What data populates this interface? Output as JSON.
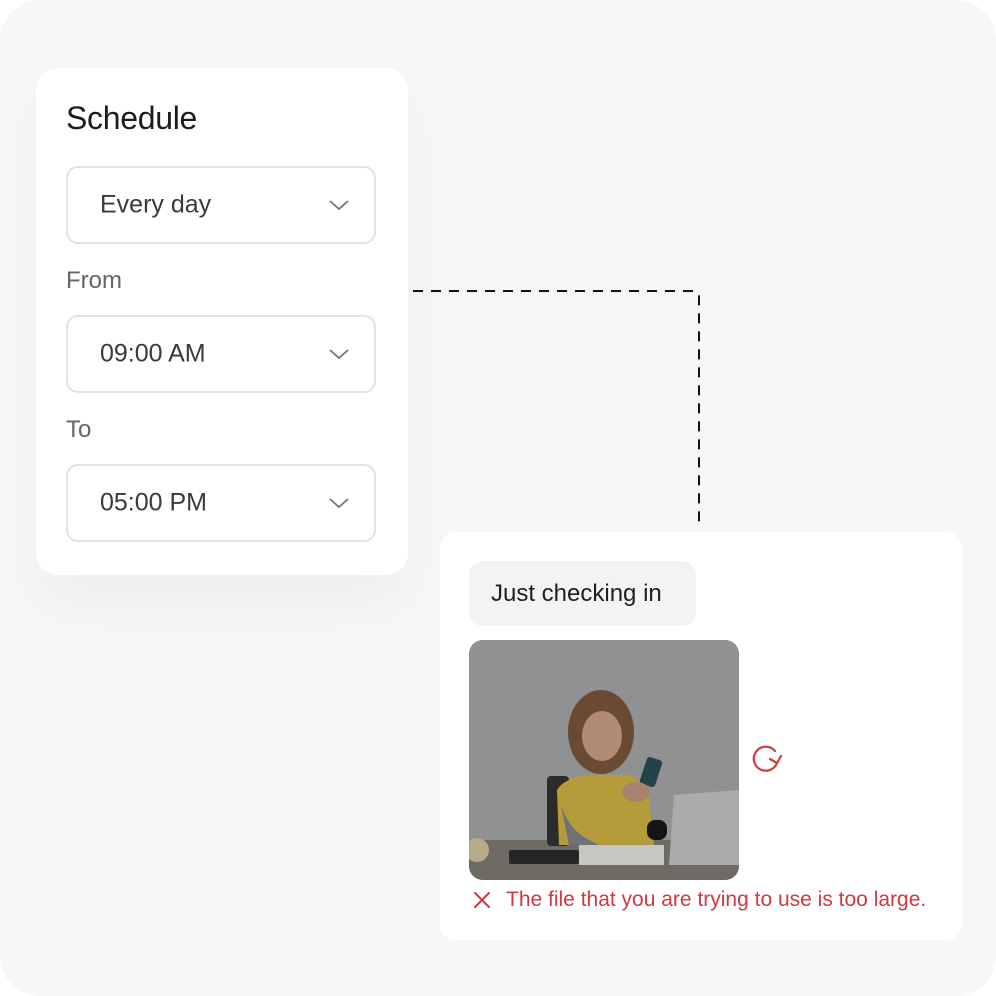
{
  "schedule": {
    "title": "Schedule",
    "frequency": {
      "value": "Every day",
      "icon": "chevron-down-icon"
    },
    "from": {
      "label": "From",
      "value": "09:00 AM",
      "icon": "chevron-down-icon"
    },
    "to": {
      "label": "To",
      "value": "05:00 PM",
      "icon": "chevron-down-icon"
    }
  },
  "chat": {
    "message": "Just checking in",
    "attachment": {
      "description": "Woman at desk looking at phone",
      "status": "failed"
    },
    "retry_icon": "retry-icon",
    "error": {
      "icon": "close-icon",
      "text": "The file that you are trying to use is too large."
    }
  },
  "colors": {
    "background": "#f6f7f9",
    "card": "#ffffff",
    "error": "#d0393f",
    "bubble": "#f3f3f3",
    "connector": "#111111"
  }
}
